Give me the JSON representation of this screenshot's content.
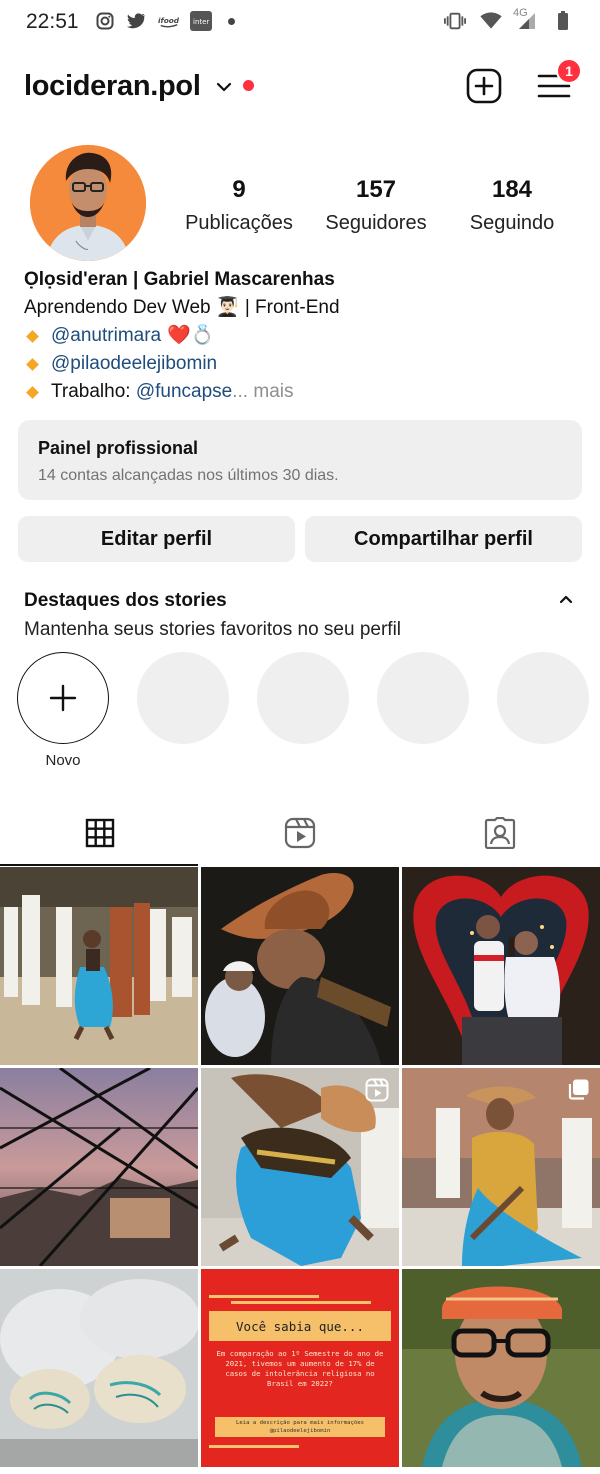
{
  "status_bar": {
    "time": "22:51",
    "left_icons": [
      "instagram-icon",
      "twitter-icon",
      "ifood-icon",
      "inter-icon"
    ],
    "network_label": "4G",
    "right_icons": [
      "vibrate-icon",
      "wifi-icon",
      "signal-icon",
      "battery-icon"
    ]
  },
  "header": {
    "username": "locideran.pol",
    "menu_badge_count": "1",
    "colors": {
      "badge": "#ff3040",
      "live_dot": "#ff3040"
    }
  },
  "profile": {
    "stats": [
      {
        "value": "9",
        "label": "Publicações"
      },
      {
        "value": "157",
        "label": "Seguidores"
      },
      {
        "value": "184",
        "label": "Seguindo"
      }
    ],
    "bio": {
      "name": "Ọlọsid'eran | Gabriel Mascarenhas",
      "line1": "Aprendendo Dev Web 👨🏻‍🎓 | Front-End",
      "link1": "@anutrimara",
      "link1_emojis": "❤️💍",
      "link2": "@pilaodeelejibomin",
      "work_prefix": "Trabalho: ",
      "work_link": "@funcapse",
      "more": "... mais"
    }
  },
  "professional_panel": {
    "title": "Painel profissional",
    "subtitle": "14 contas alcançadas nos últimos 30 dias."
  },
  "buttons": {
    "edit": "Editar perfil",
    "share": "Compartilhar perfil"
  },
  "highlights": {
    "title": "Destaques dos stories",
    "subtitle": "Mantenha seus stories favoritos no seu perfil",
    "new_label": "Novo"
  },
  "tabs": [
    "grid-icon",
    "reels-icon",
    "tagged-icon"
  ],
  "posts": [
    {
      "kind": "photo"
    },
    {
      "kind": "photo"
    },
    {
      "kind": "photo"
    },
    {
      "kind": "photo"
    },
    {
      "kind": "reel"
    },
    {
      "kind": "carousel"
    },
    {
      "kind": "photo"
    },
    {
      "kind": "text-card",
      "title": "Você sabia que...",
      "body": "Em comparação ao 1º Semestre do ano de 2021, tivemos um aumento de 17% de casos de intolerância religiosa no Brasil em 2022?",
      "footer_line1": "Leia a descrição para mais informações",
      "footer_line2": "@pilaodeelejibomin"
    },
    {
      "kind": "photo"
    }
  ]
}
